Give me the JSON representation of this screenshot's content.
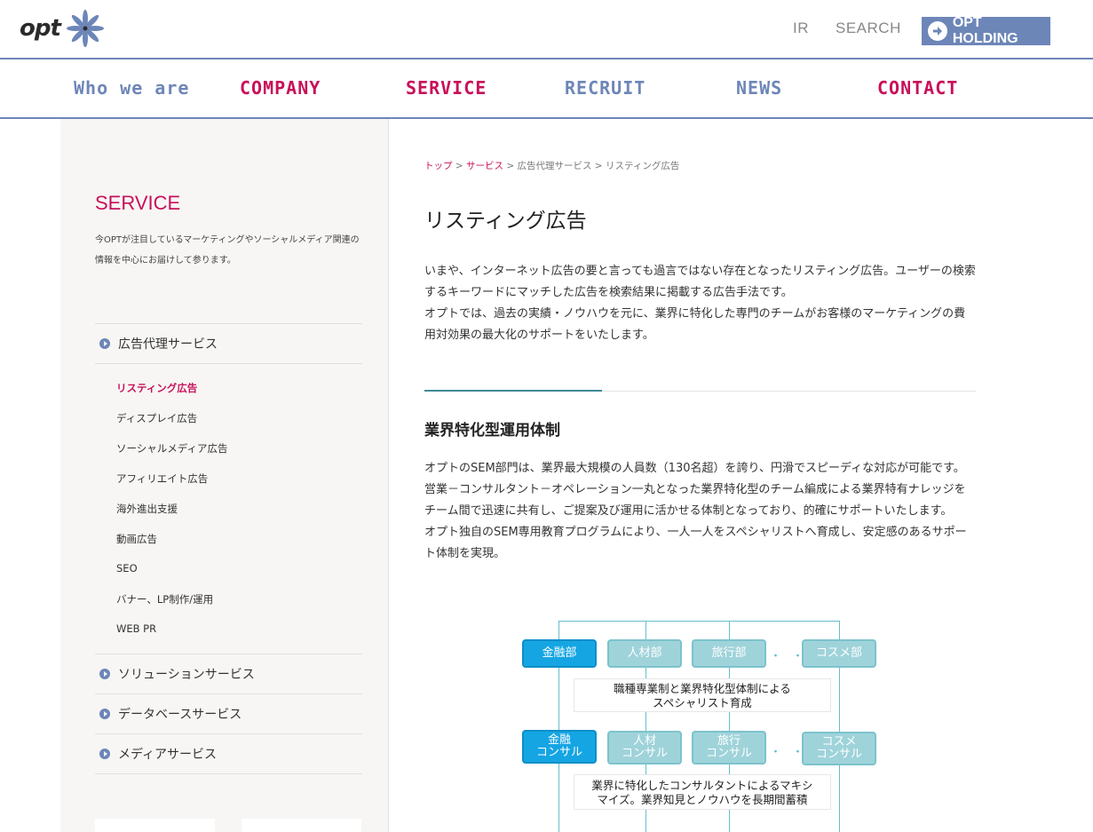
{
  "header": {
    "logo_text": "opt",
    "util_ir": "IR",
    "util_search": "SEARCH",
    "holding_label": "OPT HOLDING"
  },
  "nav": [
    "Who we are",
    "COMPANY",
    "SERVICE",
    "RECRUIT",
    "NEWS",
    "CONTACT"
  ],
  "sidebar": {
    "title": "SERVICE",
    "desc": "今OPTが注目しているマーケティングやソーシャルメディア関連の情報を中心にお届けして参ります。",
    "categories": [
      "広告代理サービス",
      "ソリューションサービス",
      "データベースサービス",
      "メディアサービス"
    ],
    "subitems": [
      "リスティング広告",
      "ディスプレイ広告",
      "ソーシャルメディア広告",
      "アフィリエイト広告",
      "海外進出支援",
      "動画広告",
      "SEO",
      "バナー、LP制作/運用",
      "WEB PR"
    ]
  },
  "main": {
    "breadcrumb": [
      "トップ",
      "サービス",
      "広告代理サービス",
      "リスティング広告"
    ],
    "breadcrumb_sep": " > ",
    "title": "リスティング広告",
    "intro": [
      "いまや、インターネット広告の要と言っても過言ではない存在となったリスティング広告。ユーザーの検索するキーワードにマッチした広告を検索結果に掲載する広告手法です。",
      "オプトでは、過去の実績・ノウハウを元に、業界に特化した専門のチームがお客様のマーケティングの費用対効果の最大化のサポートをいたします。"
    ],
    "section_title": "業界特化型運用体制",
    "section_body": [
      "オプトのSEM部門は、業界最大規模の人員数（130名超）を誇り、円滑でスピーディな対応が可能です。",
      "営業－コンサルタント－オペレーション一丸となった業界特化型のチーム編成による業界特有ナレッジをチーム間で迅速に共有し、ご提案及び運用に活かせる体制となっており、的確にサポートいたします。",
      "オプト独自のSEM専用教育プログラムにより、一人一人をスペシャリストへ育成し、安定感のあるサポート体制を実現。"
    ]
  },
  "diagram": {
    "row1": [
      "金融部",
      "人材部",
      "旅行部",
      "コスメ部"
    ],
    "text1": [
      "職種専業制と業界特化型体制による",
      "スペシャリスト育成"
    ],
    "row2": [
      "金融\nコンサル",
      "人材\nコンサル",
      "旅行\nコンサル",
      "コスメ\nコンサル"
    ],
    "text2": [
      "業界に特化したコンサルタントによるマキシ",
      "マイズ。業界知見とノウハウを長期間蓄積"
    ],
    "dots": "・・",
    "colors": {
      "accent": "#15a5e3",
      "light": "#9fd3da",
      "line": "#65bfca"
    }
  }
}
